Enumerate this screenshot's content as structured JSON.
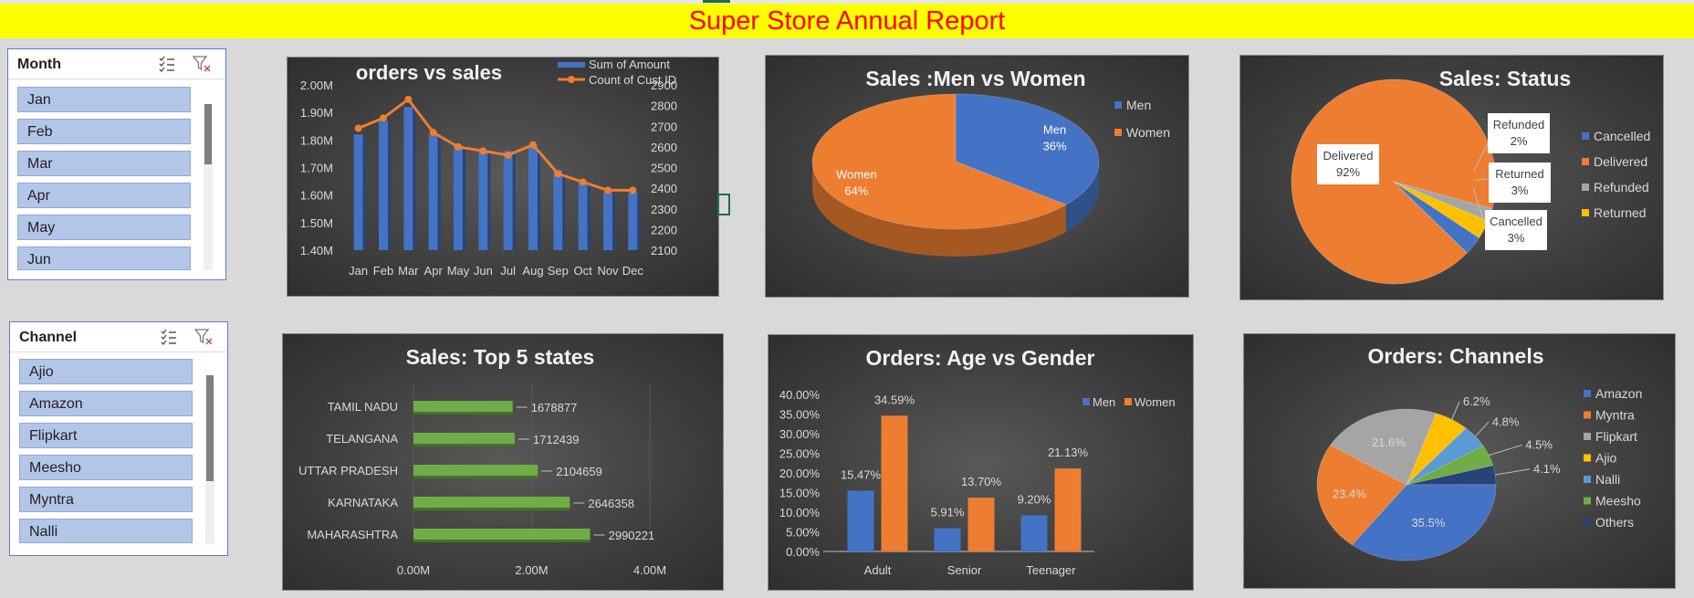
{
  "report_title": "Super Store Annual Report",
  "slicers": {
    "month": {
      "title": "Month",
      "items": [
        "Jan",
        "Feb",
        "Mar",
        "Apr",
        "May",
        "Jun"
      ]
    },
    "channel": {
      "title": "Channel",
      "items": [
        "Ajio",
        "Amazon",
        "Flipkart",
        "Meesho",
        "Myntra",
        "Nalli"
      ]
    }
  },
  "icons": {
    "multi_select": "multi-select-icon",
    "clear_filter": "clear-filter-icon"
  },
  "colors": {
    "blue": "#4472c4",
    "orange": "#ed7d31",
    "gray": "#a5a5a5",
    "yellow": "#ffc000",
    "lightblue": "#5b9bd5",
    "green": "#70ad47",
    "navy": "#264478"
  },
  "chart_data": [
    {
      "id": "orders_vs_sales",
      "type": "bar",
      "title": "orders vs sales",
      "categories": [
        "Jan",
        "Feb",
        "Mar",
        "Apr",
        "May",
        "Jun",
        "Jul",
        "Aug",
        "Sep",
        "Oct",
        "Nov",
        "Dec"
      ],
      "series": [
        {
          "name": "Sum of Amount",
          "type": "bar",
          "axis": "left",
          "values": [
            1.82,
            1.87,
            1.92,
            1.82,
            1.78,
            1.76,
            1.76,
            1.78,
            1.69,
            1.65,
            1.61,
            1.61
          ]
        },
        {
          "name": "Count of Cust ID",
          "type": "line",
          "axis": "right",
          "values": [
            2690,
            2740,
            2830,
            2670,
            2600,
            2580,
            2560,
            2610,
            2470,
            2430,
            2390,
            2390
          ]
        }
      ],
      "y_left_ticks": [
        "2.00M",
        "1.90M",
        "1.80M",
        "1.70M",
        "1.60M",
        "1.50M",
        "1.40M"
      ],
      "ylim_left": [
        1.4,
        2.0
      ],
      "y_right_ticks": [
        "2900",
        "2800",
        "2700",
        "2600",
        "2500",
        "2400",
        "2300",
        "2200",
        "2100"
      ],
      "ylim_right": [
        2100,
        2900
      ],
      "legend": "top-right"
    },
    {
      "id": "sales_gender",
      "type": "pie",
      "title": "Sales :Men vs Women",
      "slices": [
        {
          "name": "Men",
          "value": 36,
          "label": "36%"
        },
        {
          "name": "Women",
          "value": 64,
          "label": "64%"
        }
      ],
      "legend": "right"
    },
    {
      "id": "sales_status",
      "type": "pie",
      "title": "Sales: Status",
      "slices": [
        {
          "name": "Cancelled",
          "value": 3,
          "label": "3%"
        },
        {
          "name": "Delivered",
          "value": 92,
          "label": "92%"
        },
        {
          "name": "Refunded",
          "value": 2,
          "label": "2%"
        },
        {
          "name": "Returned",
          "value": 3,
          "label": "3%"
        }
      ],
      "legend": "right"
    },
    {
      "id": "top_states",
      "type": "bar",
      "orientation": "horizontal",
      "title": "Sales: Top 5 states",
      "categories": [
        "TAMIL NADU",
        "TELANGANA",
        "UTTAR PRADESH",
        "KARNATAKA",
        "MAHARASHTRA"
      ],
      "values": [
        1678877,
        1712439,
        2104659,
        2646358,
        2990221
      ],
      "x_ticks": [
        "0.00M",
        "2.00M",
        "4.00M"
      ],
      "xlim": [
        0,
        4000000
      ]
    },
    {
      "id": "age_gender",
      "type": "bar",
      "title": "Orders: Age vs Gender",
      "categories": [
        "Adult",
        "Senior",
        "Teenager"
      ],
      "series": [
        {
          "name": "Men",
          "values": [
            15.47,
            5.91,
            9.2
          ],
          "labels": [
            "15.47%",
            "5.91%",
            "9.20%"
          ]
        },
        {
          "name": "Women",
          "values": [
            34.59,
            13.7,
            21.13
          ],
          "labels": [
            "34.59%",
            "13.70%",
            "21.13%"
          ]
        }
      ],
      "y_ticks": [
        "40.00%",
        "35.00%",
        "30.00%",
        "25.00%",
        "20.00%",
        "15.00%",
        "10.00%",
        "5.00%",
        "0.00%"
      ],
      "ylim": [
        0,
        40
      ],
      "legend": "top-right"
    },
    {
      "id": "channels",
      "type": "pie",
      "title": "Orders: Channels",
      "slices": [
        {
          "name": "Amazon",
          "value": 35.5,
          "label": "35.5%"
        },
        {
          "name": "Myntra",
          "value": 23.4,
          "label": "23.4%"
        },
        {
          "name": "Flipkart",
          "value": 21.6,
          "label": "21.6%"
        },
        {
          "name": "Ajio",
          "value": 6.2,
          "label": "6.2%"
        },
        {
          "name": "Nalli",
          "value": 4.8,
          "label": "4.8%"
        },
        {
          "name": "Meesho",
          "value": 4.5,
          "label": "4.5%"
        },
        {
          "name": "Others",
          "value": 4.1,
          "label": "4.1%"
        }
      ],
      "legend": "right"
    }
  ]
}
